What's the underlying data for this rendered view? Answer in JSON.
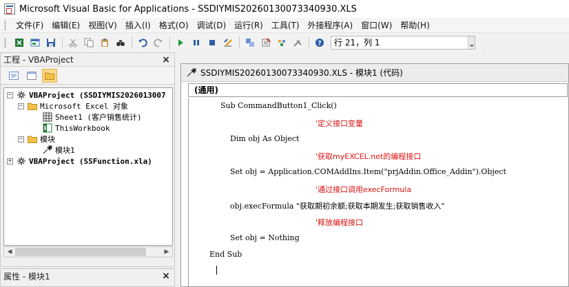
{
  "app": {
    "title": "Microsoft Visual Basic for Applications - SSDIYMIS20260130073340930.XLS"
  },
  "menu": [
    {
      "label": "文件(F)"
    },
    {
      "label": "编辑(E)"
    },
    {
      "label": "视图(V)"
    },
    {
      "label": "插入(I)"
    },
    {
      "label": "格式(O)"
    },
    {
      "label": "调试(D)"
    },
    {
      "label": "运行(R)"
    },
    {
      "label": "工具(T)"
    },
    {
      "label": "外接程序(A)"
    },
    {
      "label": "窗口(W)"
    },
    {
      "label": "帮助(H)"
    }
  ],
  "toolbar": {
    "position_text": "行 21，列 1"
  },
  "project_panel": {
    "title": "工程 - VBAProject",
    "close": "×",
    "tree": [
      {
        "label": "VBAProject (SSDIYMIS2026013007",
        "bold": true,
        "expander": "−"
      },
      {
        "label": "Microsoft Excel 对象",
        "expander": "−"
      },
      {
        "label": "Sheet1 (客户销售统计)"
      },
      {
        "label": "ThisWorkbook"
      },
      {
        "label": "模块",
        "expander": "−"
      },
      {
        "label": "模块1"
      },
      {
        "label": "VBAProject (SSFunction.xla)",
        "bold": true,
        "expander": "+"
      }
    ]
  },
  "props_panel": {
    "title": "属性 - 模块1",
    "close": "×"
  },
  "code_window": {
    "title": "SSDIYMIS20260130073340930.XLS - 模块1 (代码)",
    "object_combo": "(通用)",
    "lines": [
      {
        "text": "Sub CommandButton1_Click()",
        "kind": "code"
      },
      {
        "text": "'定义接口变量",
        "kind": "comment"
      },
      {
        "text": "Dim obj As Object",
        "kind": "code"
      },
      {
        "text": "'获取myEXCEL.net的编程接口",
        "kind": "comment"
      },
      {
        "text": "Set obj = Application.COMAddIns.Item(\"prjAddin.Office_Addin\").Object",
        "kind": "code"
      },
      {
        "text": "'通过接口调用execFormula",
        "kind": "comment"
      },
      {
        "text": "obj.execFormula \"获取期初余额;获取本期发生;获取销售收入\"",
        "kind": "code"
      },
      {
        "text": "'释放编程接口",
        "kind": "comment"
      },
      {
        "text": "Set obj = Nothing",
        "kind": "code"
      },
      {
        "text": "End Sub",
        "kind": "code"
      }
    ]
  },
  "colors": {
    "comment": "#d11111",
    "selection_accent": "#ffd98a"
  }
}
